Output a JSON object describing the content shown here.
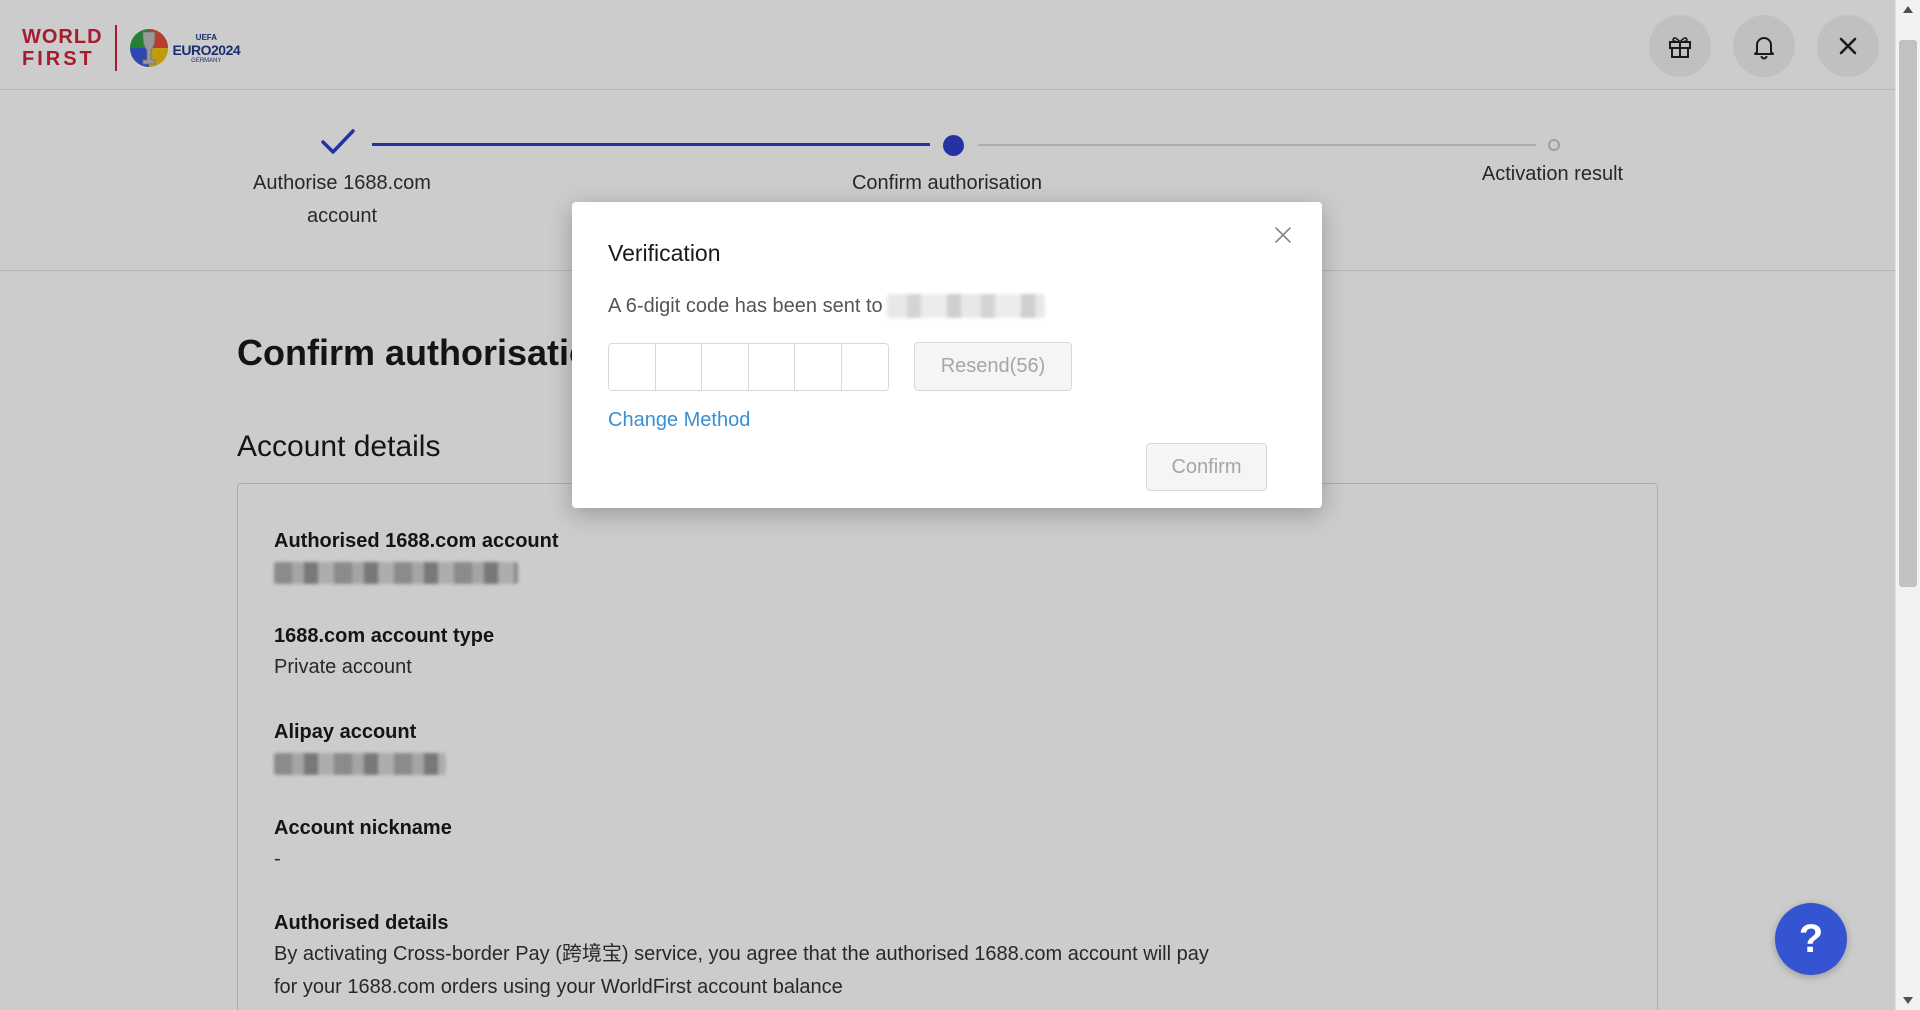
{
  "header": {
    "logo_line1": "WORLD",
    "logo_line2": "FIRST",
    "euro_uefa": "UEFA",
    "euro_name": "EURO2024",
    "euro_country": "GERMANY",
    "icons": [
      "gift-icon",
      "bell-icon",
      "close-icon"
    ]
  },
  "stepper": {
    "steps": [
      {
        "label_line1": "Authorise 1688.com",
        "label_line2": "account",
        "status": "done"
      },
      {
        "label_line1": "Confirm authorisation",
        "status": "active"
      },
      {
        "label_line1": "Activation result",
        "status": "pending"
      }
    ],
    "accent_color": "#2f3fcc"
  },
  "main": {
    "page_title": "Confirm authorisation",
    "section_title": "Account details",
    "fields": [
      {
        "label": "Authorised 1688.com account",
        "value": "",
        "masked": true
      },
      {
        "label": "1688.com account type",
        "value": "Private account"
      },
      {
        "label": "Alipay account",
        "value": "",
        "masked": true
      },
      {
        "label": "Account nickname",
        "value": "-"
      },
      {
        "label": "Authorised details",
        "value_line1": "By activating Cross-border Pay (跨境宝) service, you agree that the authorised 1688.com account will pay",
        "value_line2": "for your 1688.com orders using your WorldFirst account balance"
      }
    ]
  },
  "modal": {
    "title": "Verification",
    "description": "A 6-digit code has been sent to",
    "code_length": 6,
    "resend_label": "Resend(56)",
    "change_method_label": "Change Method",
    "confirm_label": "Confirm",
    "link_color": "#3c8fcf"
  },
  "help": {
    "label": "?",
    "color": "#3554d1"
  }
}
